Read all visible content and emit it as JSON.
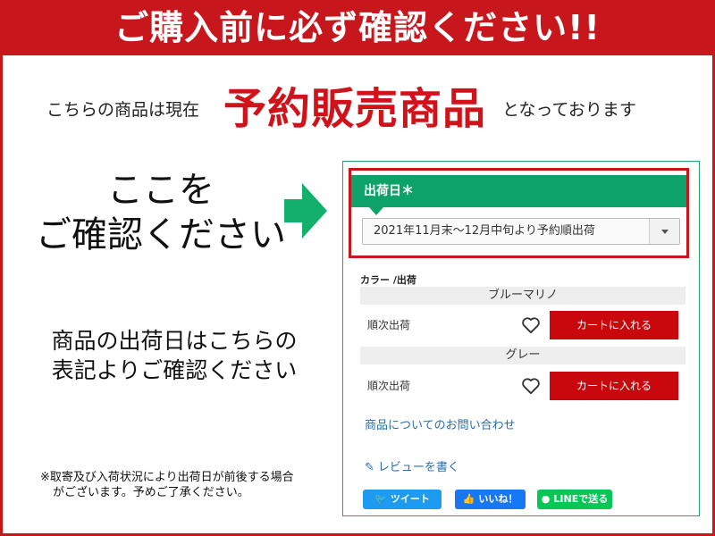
{
  "banner": {
    "title": "ご購入前に必ず確認ください!!"
  },
  "intro": {
    "prefix": "こちらの商品は現在",
    "emphasis": "予約販売商品",
    "suffix": "となっております"
  },
  "callout": {
    "line1": "ここを",
    "line2": "ご確認ください"
  },
  "date_note": {
    "line1": "商品の出荷日はこちらの",
    "line2": "表記よりご確認ください"
  },
  "footnote": {
    "line1": "※取寄及び入荷状況により出荷日が前後する場合",
    "line2": "がございます。予めご了承ください。"
  },
  "panel": {
    "ship_date": {
      "label": "出荷日＊",
      "selected": "2021年11月末～12月中旬より予約順出荷"
    },
    "color_label": "カラー /出荷",
    "variants": [
      {
        "color": "ブルーマリノ",
        "status": "順次出荷",
        "cart_label": "カートに入れる"
      },
      {
        "color": "グレー",
        "status": "順次出荷",
        "cart_label": "カートに入れる"
      }
    ],
    "inquiry_link": "商品についてのお問い合わせ",
    "review_link": "レビューを書く",
    "social": {
      "tweet": "ツイート",
      "like": "いいね！",
      "line": "LINEで送る"
    }
  },
  "colors": {
    "brand_red": "#c8161d",
    "ship_green": "#0ea26b",
    "link_blue": "#2a6db0"
  }
}
